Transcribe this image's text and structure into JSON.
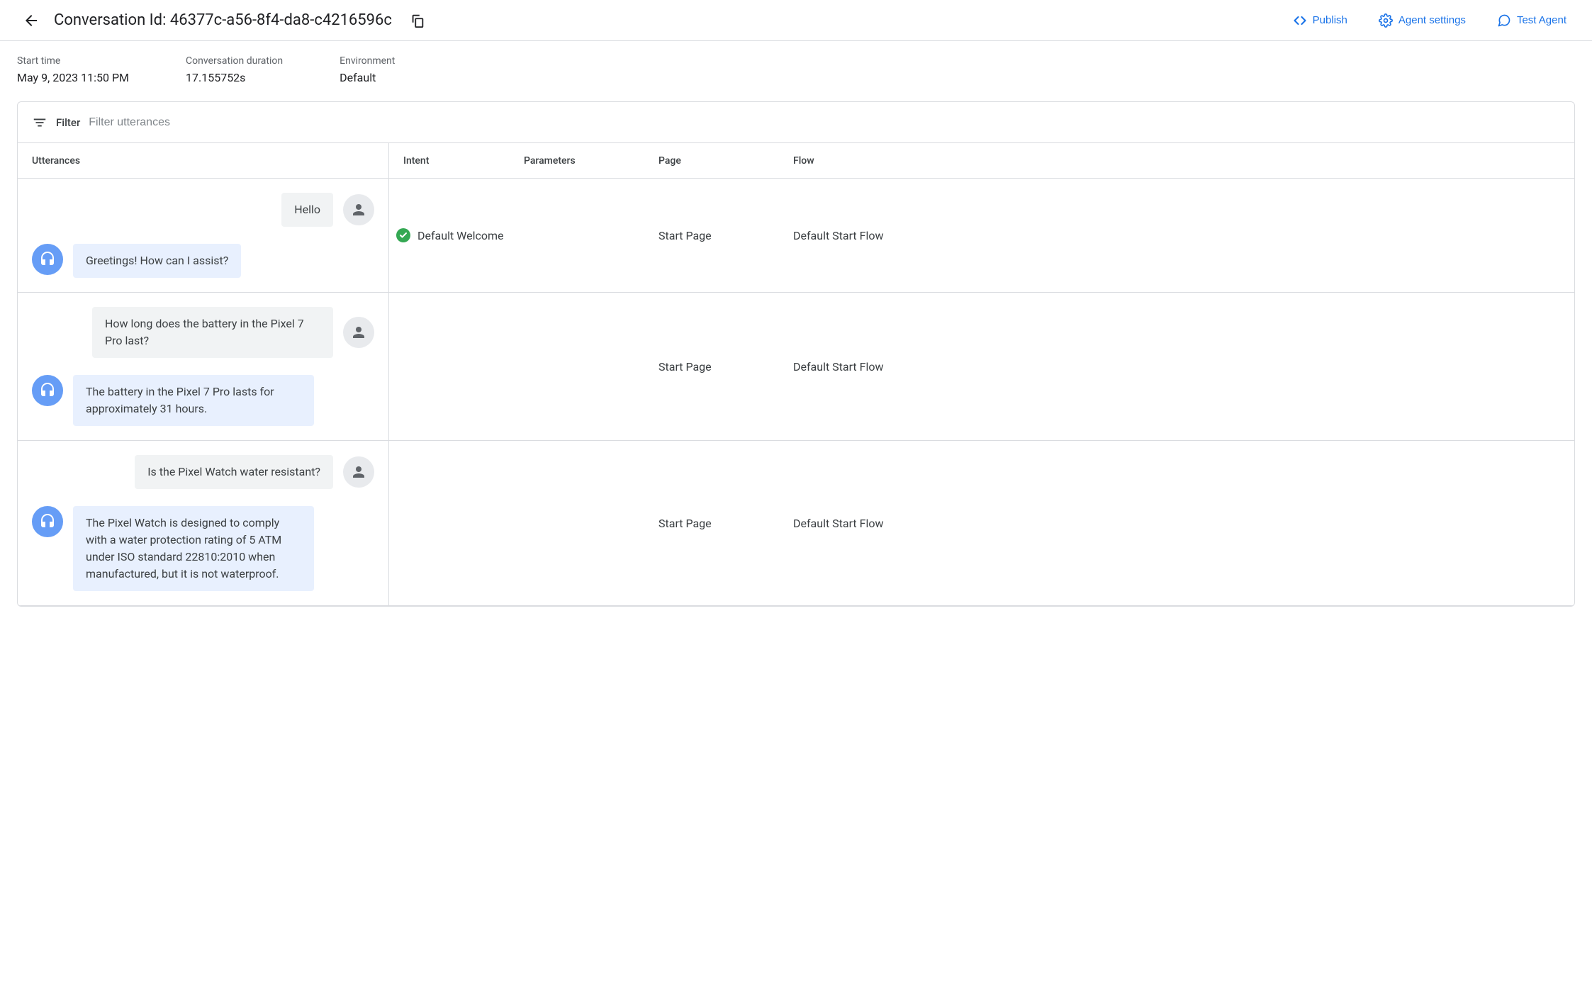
{
  "header": {
    "title": "Conversation Id: 46377c-a56-8f4-da8-c4216596c",
    "actions": {
      "publish": "Publish",
      "agent_settings": "Agent settings",
      "test_agent": "Test Agent"
    }
  },
  "meta": {
    "start_time_label": "Start time",
    "start_time_value": "May 9, 2023 11:50 PM",
    "duration_label": "Conversation duration",
    "duration_value": "17.155752s",
    "environment_label": "Environment",
    "environment_value": "Default"
  },
  "filter": {
    "label": "Filter",
    "placeholder": "Filter utterances"
  },
  "columns": {
    "utterances": "Utterances",
    "intent": "Intent",
    "parameters": "Parameters",
    "page": "Page",
    "flow": "Flow"
  },
  "turns": [
    {
      "user": "Hello",
      "agent": "Greetings! How can I assist?",
      "intent_matched": true,
      "intent": "Default Welcome",
      "parameters": "",
      "page": "Start Page",
      "flow": "Default Start Flow"
    },
    {
      "user": "How long does the battery in the Pixel 7 Pro last?",
      "agent": "The battery in the Pixel 7 Pro lasts for approximately 31 hours.",
      "intent_matched": false,
      "intent": "",
      "parameters": "",
      "page": "Start Page",
      "flow": "Default Start Flow"
    },
    {
      "user": "Is the Pixel Watch water resistant?",
      "agent": "The Pixel Watch is designed to comply with a water protection rating of 5 ATM under ISO standard 22810:2010 when manufactured, but it is not waterproof.",
      "intent_matched": false,
      "intent": "",
      "parameters": "",
      "page": "Start Page",
      "flow": "Default Start Flow"
    }
  ]
}
